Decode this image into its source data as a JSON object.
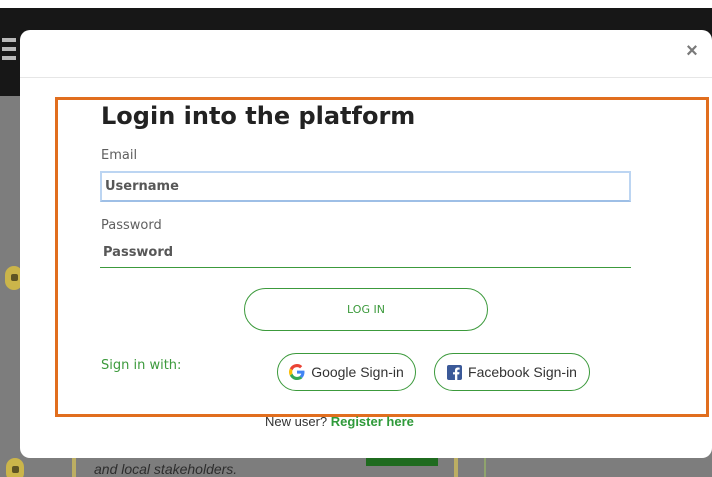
{
  "background": {
    "italic_text": "and local stakeholders."
  },
  "modal": {
    "close_label": "×",
    "title": "Login into the platform",
    "email": {
      "label": "Email",
      "placeholder": "Username",
      "value": ""
    },
    "password": {
      "label": "Password",
      "placeholder": "Password",
      "value": ""
    },
    "login_button_label": "LOG IN",
    "signin_with_label": "Sign in with:",
    "social": {
      "google": {
        "label": "Google Sign-in",
        "icon": "google-icon"
      },
      "facebook": {
        "label": "Facebook Sign-in",
        "icon": "facebook-icon"
      }
    },
    "register": {
      "prompt": "New user?",
      "link_label": "Register here"
    }
  },
  "colors": {
    "accent_green": "#3c9a3c",
    "highlight_orange": "#e16e1e",
    "facebook_blue": "#3b5998"
  }
}
